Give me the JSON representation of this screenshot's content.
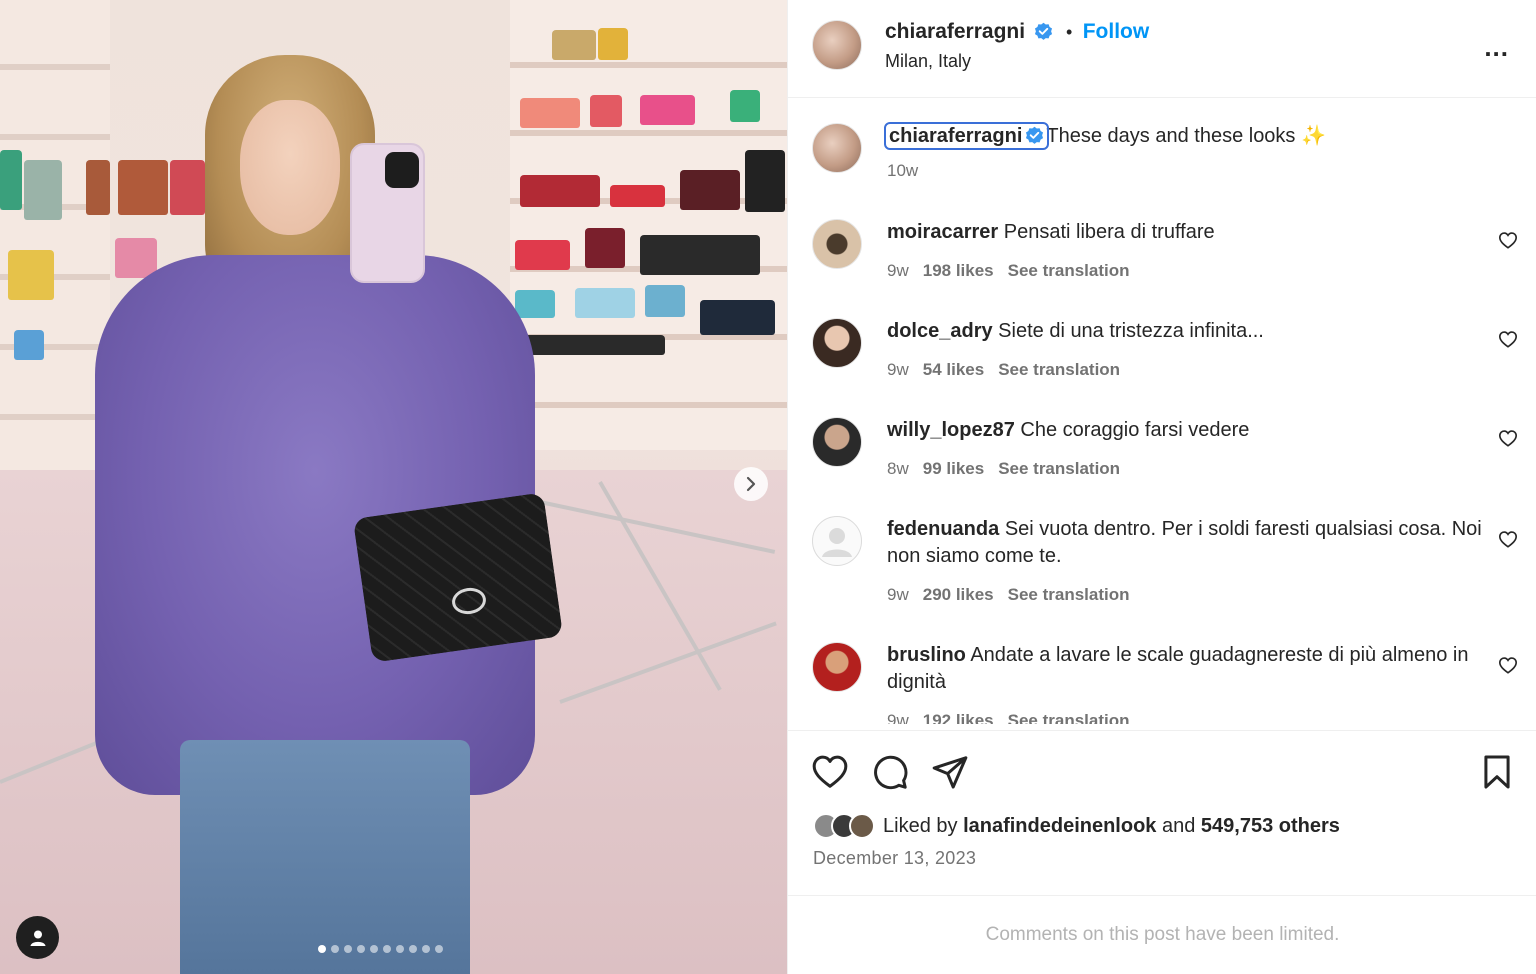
{
  "post": {
    "author": "chiaraferragni",
    "location": "Milan, Italy",
    "follow_label": "Follow",
    "separator": "•",
    "more_label": "...",
    "caption": "These days and these looks",
    "caption_emoji": "✨",
    "caption_time": "10w",
    "carousel": {
      "slides": 10,
      "active_slide": 1,
      "next_icon": "chevron-right-icon"
    }
  },
  "comments": [
    {
      "user": "moiracarrer",
      "text": "Pensati libera di truffare",
      "time": "9w",
      "likes": "198 likes",
      "translate": "See translation"
    },
    {
      "user": "dolce_adry",
      "text": "Siete di una tristezza infinita...",
      "time": "9w",
      "likes": "54 likes",
      "translate": "See translation"
    },
    {
      "user": "willy_lopez87",
      "text": "Che coraggio farsi vedere",
      "time": "8w",
      "likes": "99 likes",
      "translate": "See translation"
    },
    {
      "user": "fedenuanda",
      "text": "Sei vuota dentro. Per i soldi faresti qualsiasi cosa. Noi non siamo come te.",
      "time": "9w",
      "likes": "290 likes",
      "translate": "See translation"
    },
    {
      "user": "bruslino",
      "text": "Andate a lavare le scale guadagnereste di più almeno in dignità",
      "time": "9w",
      "likes": "192 likes",
      "translate": "See translation"
    }
  ],
  "engagement": {
    "liked_prefix": "Liked by",
    "liked_user": "lanafindedeinenlook",
    "liked_and": "and",
    "liked_others": "549,753 others",
    "date": "December 13, 2023",
    "comments_limited": "Comments on this post have been limited."
  },
  "colors": {
    "accent": "#0095f6",
    "verified": "#3897f0",
    "text": "#262626",
    "muted": "#737373"
  }
}
